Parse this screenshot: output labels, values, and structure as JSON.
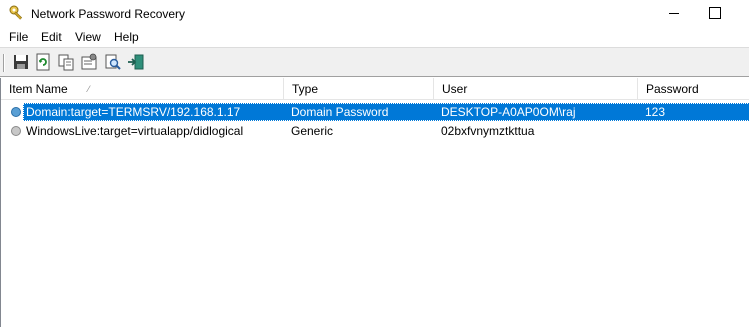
{
  "window": {
    "title": "Network Password Recovery",
    "icon": "key-app-icon"
  },
  "menu": [
    "File",
    "Edit",
    "View",
    "Help"
  ],
  "toolbar": {
    "buttons": [
      "save-icon",
      "refresh-icon",
      "copy-icon",
      "properties-icon",
      "find-icon",
      "exit-icon"
    ]
  },
  "list": {
    "columns": [
      {
        "label": "Item Name",
        "sorted": true
      },
      {
        "label": "Type"
      },
      {
        "label": "User"
      },
      {
        "label": "Password"
      }
    ],
    "sort_indicator": "⁄",
    "rows": [
      {
        "item_name": "Domain:target=TERMSRV/192.168.1.17",
        "type": "Domain Password",
        "user": "DESKTOP-A0AP0OM\\raj",
        "password": "123",
        "selected": true,
        "icon_color": "#5a9fd4"
      },
      {
        "item_name": "WindowsLive:target=virtualapp/didlogical",
        "type": "Generic",
        "user": "02bxfvnymztkttua",
        "password": "",
        "selected": false,
        "icon_color": "#b0b0b0"
      }
    ]
  },
  "colors": {
    "selection": "#0078d7",
    "toolbar_bg": "#f0f0f0"
  }
}
